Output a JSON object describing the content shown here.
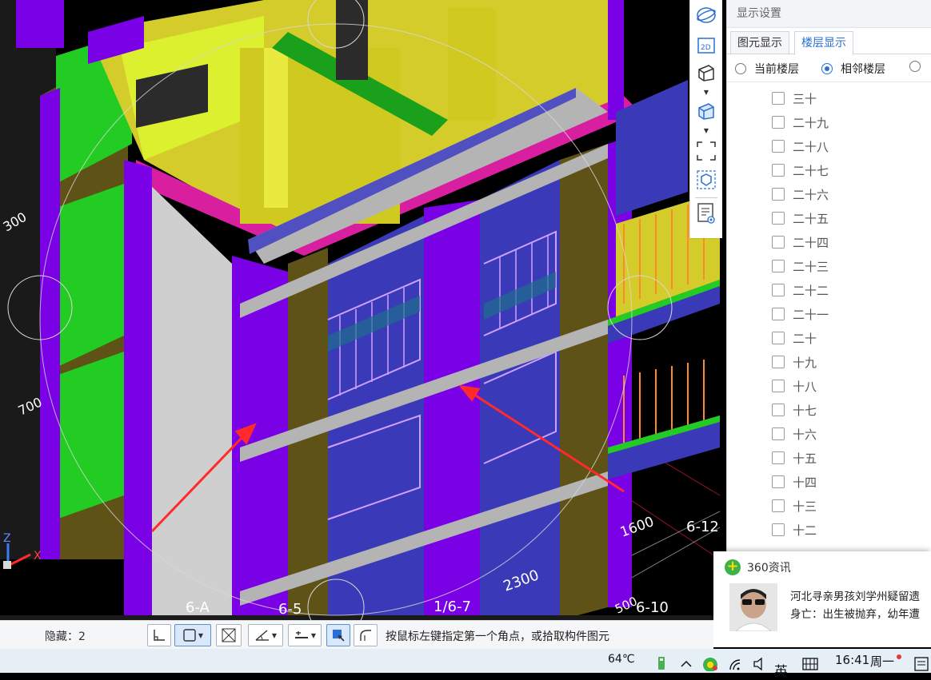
{
  "viewport": {
    "axis_labels": [
      "6-A",
      "6-5",
      "1/6-7",
      "6-10",
      "6-12"
    ],
    "dimension_labels": [
      "2300",
      "1600",
      "300",
      "700",
      "500"
    ],
    "axis_x_label": "X",
    "axis_z_label": "Z"
  },
  "toolbar_vertical": {
    "icons": [
      "orbit-icon",
      "view-2d-icon",
      "view-3d-cube-icon",
      "view-3d-solid-icon",
      "fit-view-icon",
      "component-view-icon",
      "display-settings-icon"
    ],
    "view_2d_label": "2D"
  },
  "panel": {
    "title": "显示设置",
    "tabs": [
      {
        "label": "图元显示",
        "active": false
      },
      {
        "label": "楼层显示",
        "active": true
      }
    ],
    "floor_modes": [
      {
        "label": "当前楼层",
        "checked": false
      },
      {
        "label": "相邻楼层",
        "checked": true
      }
    ],
    "floors": [
      "三十",
      "二十九",
      "二十八",
      "二十七",
      "二十六",
      "二十五",
      "二十四",
      "二十三",
      "二十二",
      "二十一",
      "二十",
      "十九",
      "十八",
      "十七",
      "十六",
      "十五",
      "十四",
      "十三",
      "十二"
    ]
  },
  "news": {
    "source": "360资讯",
    "line1": "河北寻亲男孩刘学州疑留遗",
    "line2": "身亡：出生被抛弃，幼年遭"
  },
  "statusbar": {
    "hidden_label": "隐藏：2",
    "hint": "按鼠标左键指定第一个角点，或拾取构件图元"
  },
  "taskbar": {
    "temperature": "64℃",
    "ime": "英",
    "time": "16:41",
    "weekday": "周一"
  }
}
